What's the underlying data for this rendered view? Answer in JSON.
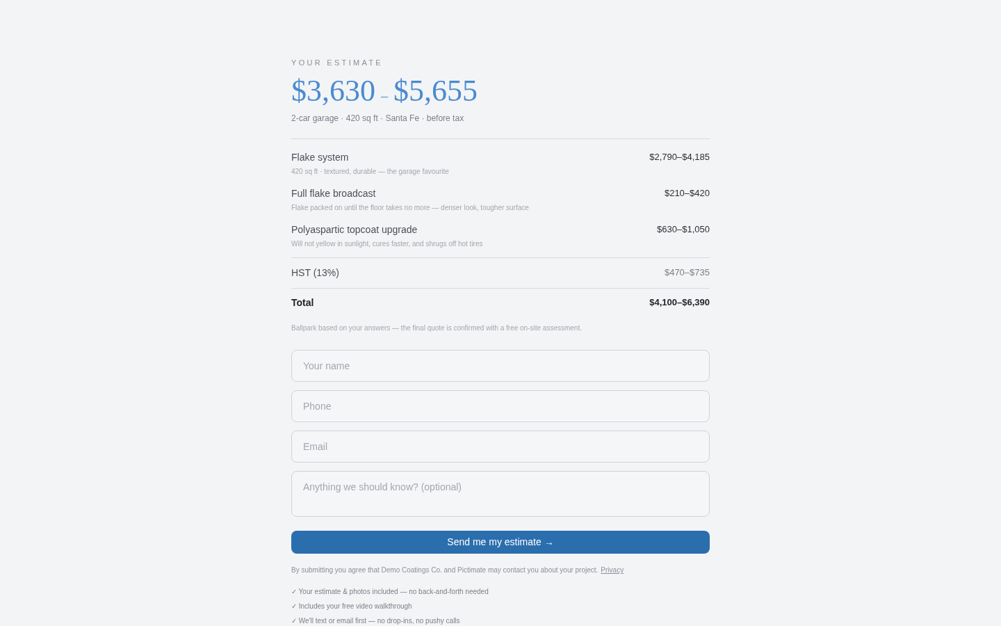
{
  "eyebrow": "YOUR ESTIMATE",
  "range": {
    "low": "$3,630",
    "separator": "–",
    "high": "$5,655"
  },
  "summary": "2-car garage · 420 sq ft · Santa Fe · before tax",
  "line_items": [
    {
      "name": "Flake system",
      "detail": "420 sq ft · textured, durable — the garage favourite",
      "price": "$2,790–$4,185"
    },
    {
      "name": "Full flake broadcast",
      "detail": "Flake packed on until the floor takes no more — denser look, tougher surface",
      "price": "$210–$420"
    },
    {
      "name": "Polyaspartic topcoat upgrade",
      "detail": "Will not yellow in sunlight, cures faster, and shrugs off hot tires",
      "price": "$630–$1,050"
    }
  ],
  "tax": {
    "label": "HST (13%)",
    "amount": "$470–$735"
  },
  "total": {
    "label": "Total",
    "amount": "$4,100–$6,390"
  },
  "note": "Ballpark based on your answers — the final quote is confirmed with a free on-site assessment.",
  "fields": [
    {
      "kind": "input",
      "placeholder": "Your name"
    },
    {
      "kind": "input",
      "placeholder": "Phone"
    },
    {
      "kind": "input",
      "placeholder": "Email"
    },
    {
      "kind": "textarea",
      "placeholder": "Anything we should know? (optional)"
    }
  ],
  "submit": "Send me my estimate →",
  "consent": {
    "text": "By submitting you agree that Demo Coatings Co. and Pictimate may contact you about your project.",
    "link": "Privacy"
  },
  "benefits": [
    "✓ Your estimate & photos included — no back-and-forth needed",
    "✓ Includes your free video walkthrough",
    "✓ We'll text or email first — no drop-ins, no pushy calls"
  ]
}
